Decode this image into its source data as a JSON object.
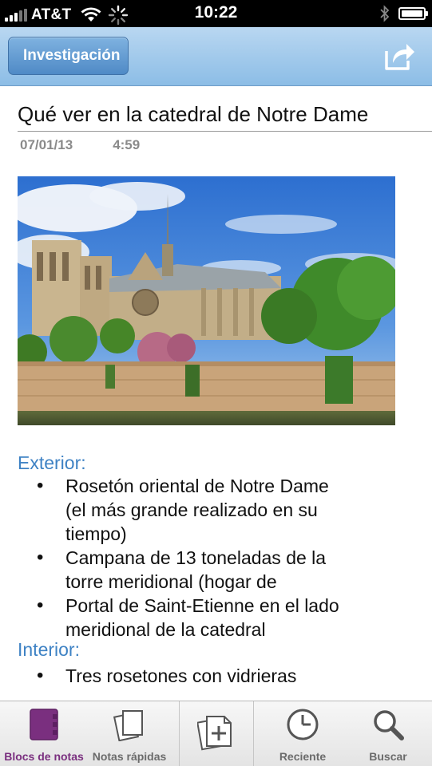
{
  "status_bar": {
    "carrier": "AT&T",
    "time": "10:22"
  },
  "nav": {
    "back_label": "Investigación"
  },
  "note": {
    "title": "Qué ver en la catedral de Notre Dame",
    "date": "07/01/13",
    "time": "4:59",
    "sections": [
      {
        "heading": "Exterior:",
        "items": [
          "Rosetón oriental de Notre Dame (el más grande realizado en su tiempo)",
          "Campana de 13 toneladas de la torre meridional (hogar de",
          "Portal de Saint-Etienne en el lado meridional de la catedral"
        ]
      },
      {
        "heading": "Interior:",
        "items": [
          "Tres rosetones con vidrieras"
        ]
      }
    ]
  },
  "tabbar": {
    "notebooks": "Blocs de notas",
    "quick_notes": "Notas rápidas",
    "recent": "Reciente",
    "search": "Buscar"
  },
  "colors": {
    "accent_purple": "#7a2f7f",
    "section_blue": "#3e82c4",
    "nav_blue": "#8cbde6"
  }
}
